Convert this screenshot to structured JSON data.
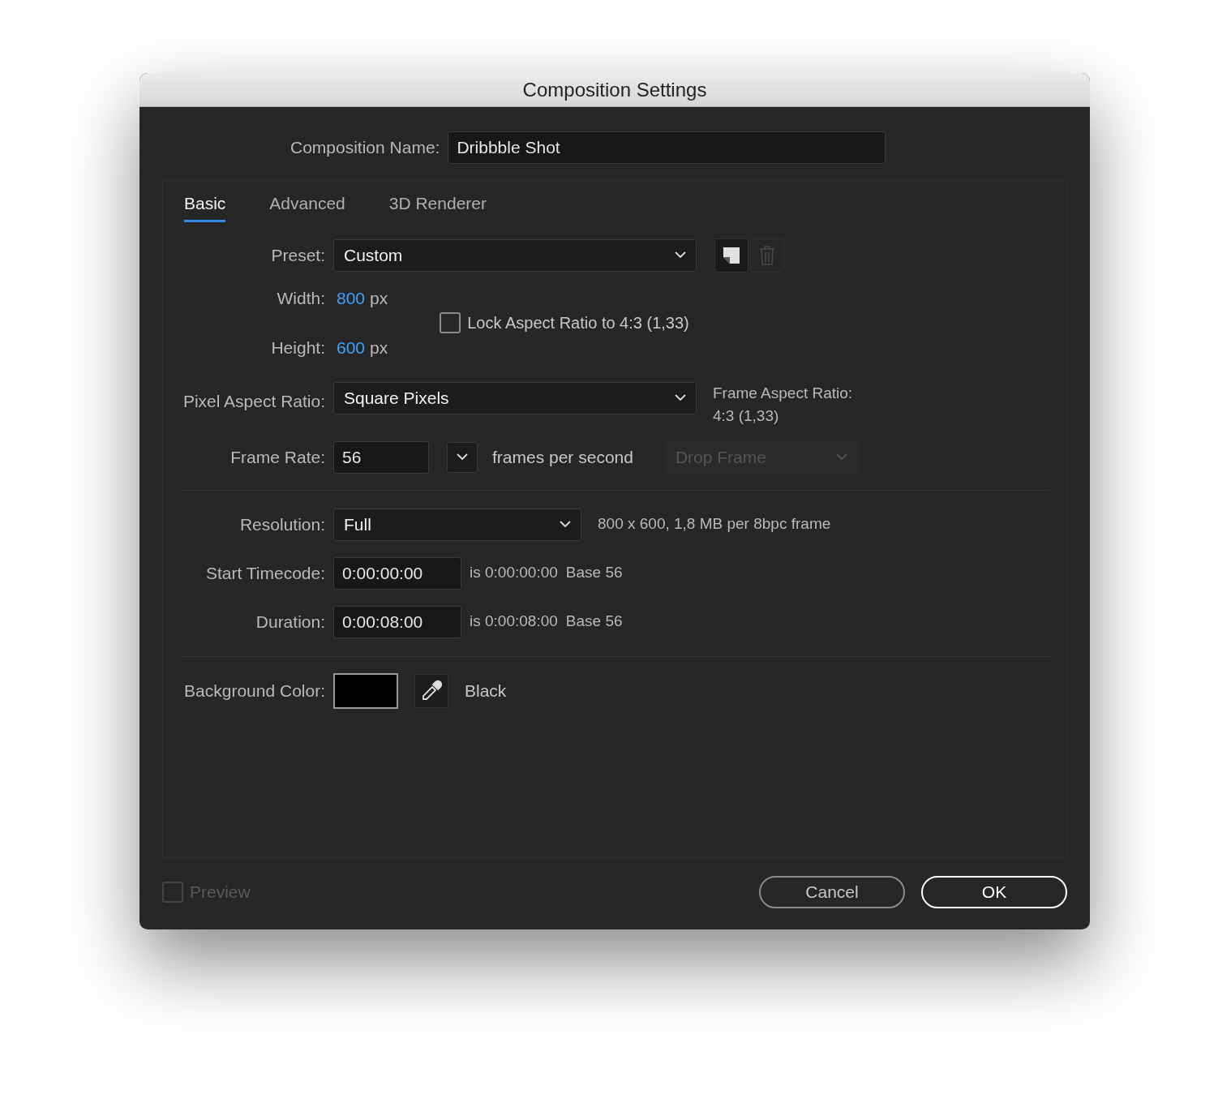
{
  "window": {
    "title": "Composition Settings"
  },
  "composition_name": {
    "label": "Composition Name:",
    "value": "Dribbble Shot"
  },
  "tabs": [
    {
      "label": "Basic",
      "selected": true
    },
    {
      "label": "Advanced",
      "selected": false
    },
    {
      "label": "3D Renderer",
      "selected": false
    }
  ],
  "preset": {
    "label": "Preset:",
    "value": "Custom",
    "delete_disabled": true
  },
  "width": {
    "label": "Width:",
    "value": "800",
    "unit": "px"
  },
  "height": {
    "label": "Height:",
    "value": "600",
    "unit": "px"
  },
  "lock_aspect": {
    "label": "Lock Aspect Ratio to 4:3 (1,33)",
    "checked": false
  },
  "pixel_aspect": {
    "label": "Pixel Aspect Ratio:",
    "value": "Square Pixels"
  },
  "frame_aspect": {
    "label": "Frame Aspect Ratio:",
    "value": "4:3 (1,33)"
  },
  "frame_rate": {
    "label": "Frame Rate:",
    "value": "56",
    "suffix": "frames per second"
  },
  "drop_frame": {
    "value": "Drop Frame",
    "disabled": true
  },
  "resolution": {
    "label": "Resolution:",
    "value": "Full",
    "info": "800 x 600, 1,8 MB per 8bpc frame"
  },
  "start_timecode": {
    "label": "Start Timecode:",
    "value": "0:00:00:00",
    "info": "is 0:00:00:00",
    "base": "Base 56"
  },
  "duration": {
    "label": "Duration:",
    "value": "0:00:08:00",
    "info": "is 0:00:08:00",
    "base": "Base 56"
  },
  "background_color": {
    "label": "Background Color:",
    "color": "#000000",
    "name": "Black"
  },
  "preview": {
    "label": "Preview",
    "checked": false,
    "disabled": true
  },
  "buttons": [
    {
      "label": "Cancel",
      "kind": "cancel"
    },
    {
      "label": "OK",
      "kind": "default"
    }
  ]
}
